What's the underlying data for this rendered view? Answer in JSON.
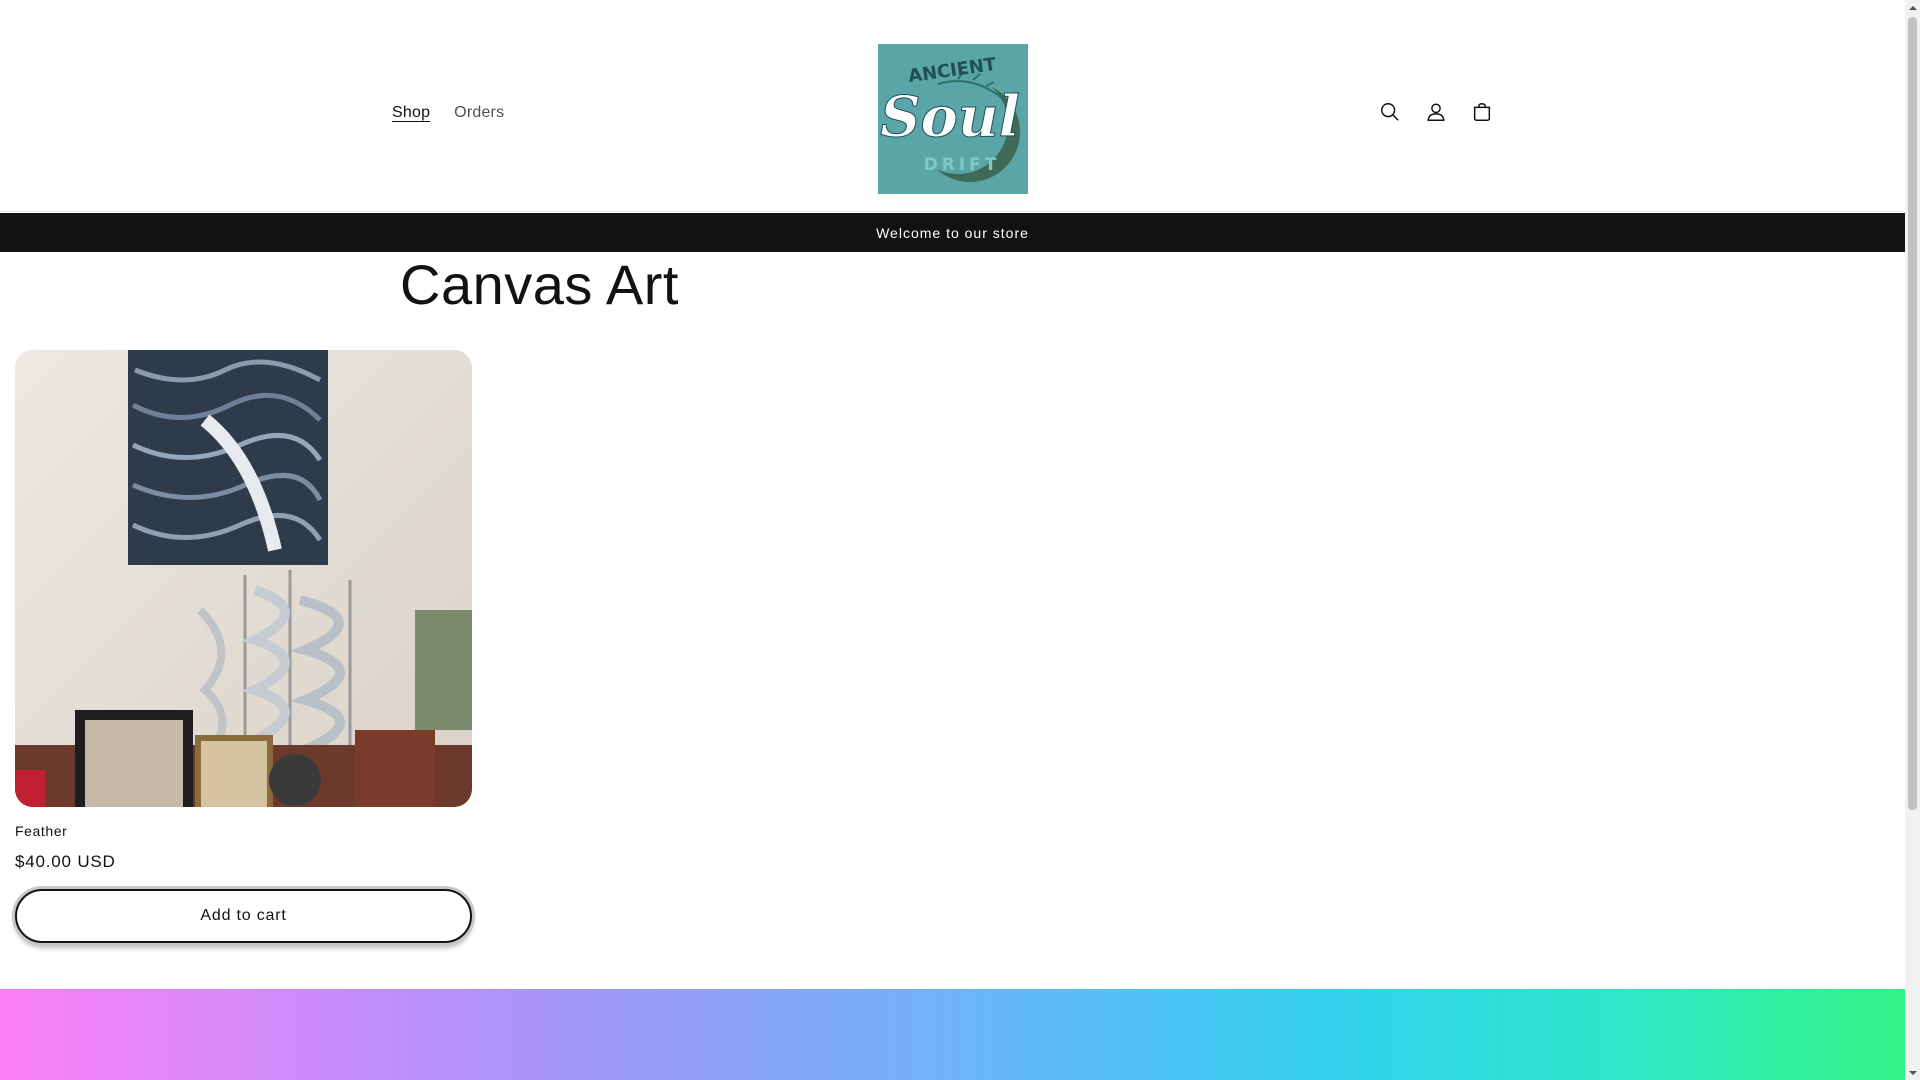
{
  "header": {
    "nav": [
      {
        "label": "Shop",
        "active": true
      },
      {
        "label": "Orders",
        "active": false
      }
    ],
    "logo": {
      "line1": "ANCIENT",
      "line2": "Soul",
      "line3": "DRIFT",
      "background": "#5aa5a8"
    },
    "icons": [
      "search-icon",
      "account-icon",
      "cart-icon"
    ]
  },
  "announcement": {
    "text": "Welcome to our store"
  },
  "collection": {
    "title": "Canvas Art"
  },
  "products": [
    {
      "title": "Feather",
      "price": "$40.00 USD",
      "add_to_cart_label": "Add to cart"
    }
  ],
  "colors": {
    "announcement_bg": "#121212",
    "gradient": [
      "#fb7ff7",
      "#a995fb",
      "#6fb4fa",
      "#33d2f0",
      "#2ee7c9",
      "#33f283"
    ]
  }
}
